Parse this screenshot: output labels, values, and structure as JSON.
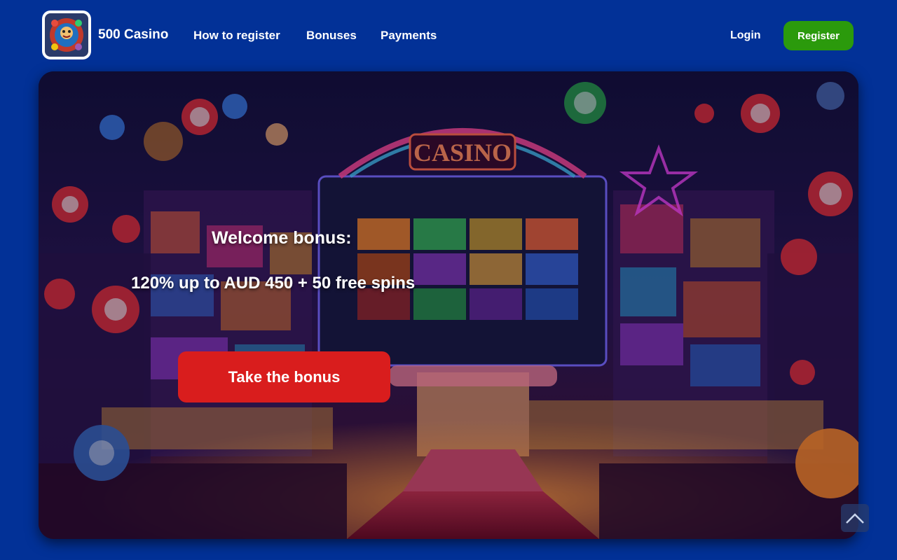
{
  "header": {
    "brand": "500 Casino",
    "nav": [
      {
        "label": "How to register"
      },
      {
        "label": "Bonuses"
      },
      {
        "label": "Payments"
      }
    ],
    "login_label": "Login",
    "register_label": "Register"
  },
  "hero": {
    "sign_text": "CASINO",
    "welcome": "Welcome bonus:",
    "offer": "120% up to AUD 450 + 50 free spins",
    "cta_label": "Take the bonus"
  },
  "icons": {
    "logo": "casino-logo-icon",
    "scroll_top": "chevron-up-icon"
  },
  "colors": {
    "page_bg": "#023197",
    "register_bg": "#2b9a0c",
    "cta_bg": "#d91d1d"
  }
}
